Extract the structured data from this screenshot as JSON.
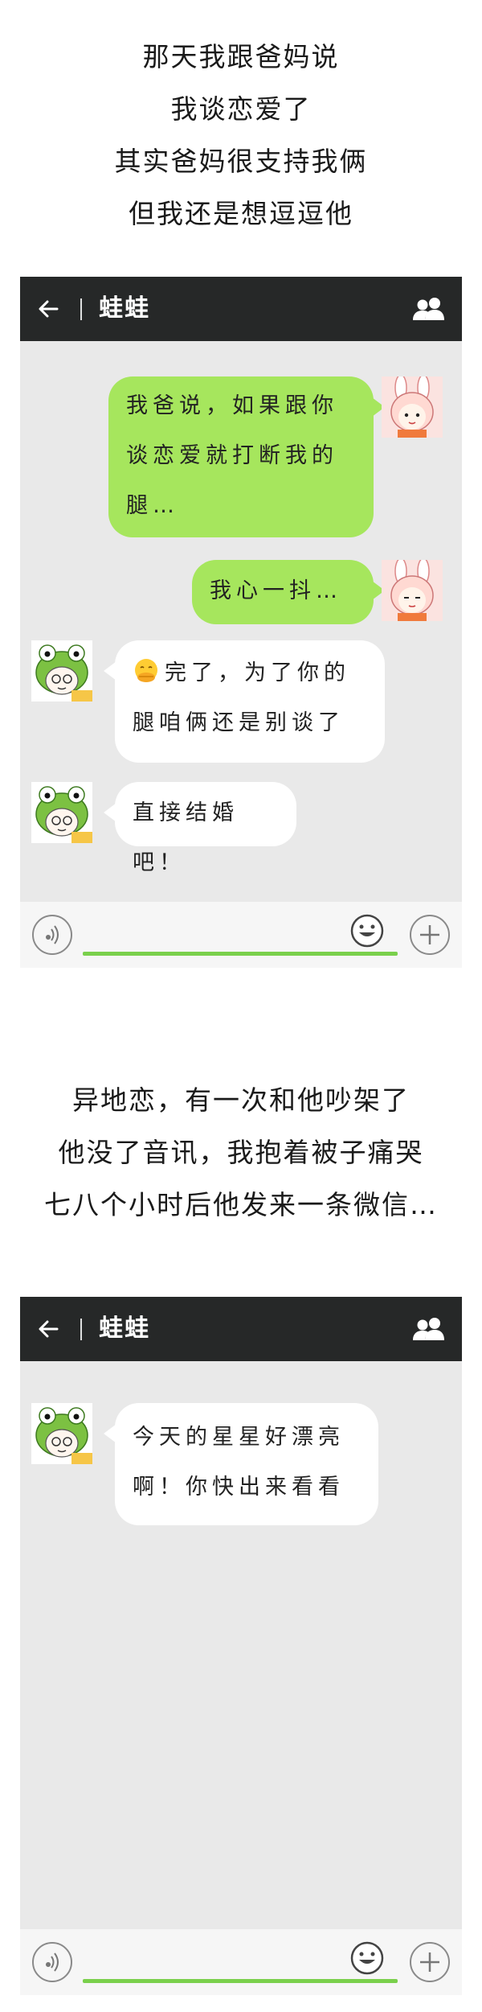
{
  "caption1": {
    "lines": [
      "那天我跟爸妈说",
      "我谈恋爱了",
      "其实爸妈很支持我俩",
      "但我还是想逗逗他"
    ]
  },
  "phone1": {
    "header": {
      "back_icon": "arrow-left-icon",
      "title": "蛙蛙",
      "people_icon": "contacts-icon"
    },
    "messages": [
      {
        "side": "right",
        "text": "我爸说，如果跟你\n谈恋爱就打断我的\n腿…"
      },
      {
        "side": "right",
        "text": "我心一抖…"
      },
      {
        "side": "left",
        "emoji": "face-with-hand-over-mouth",
        "text": "完了，为了你的\n腿咱俩还是别谈了"
      },
      {
        "side": "left",
        "text": "直接结婚吧！"
      }
    ],
    "inputbar": {
      "voice_icon": "voice-icon",
      "emoji_icon": "smile-icon",
      "plus_icon": "plus-icon"
    }
  },
  "caption2": {
    "lines": [
      "异地恋，有一次和他吵架了",
      "他没了音讯，我抱着被子痛哭",
      "七八个小时后他发来一条微信…"
    ]
  },
  "phone2": {
    "header": {
      "back_icon": "arrow-left-icon",
      "title": "蛙蛙",
      "people_icon": "contacts-icon"
    },
    "messages": [
      {
        "side": "left",
        "text": "今天的星星好漂亮\n啊！你快出来看看"
      }
    ],
    "inputbar": {
      "voice_icon": "voice-icon",
      "emoji_icon": "smile-icon",
      "plus_icon": "plus-icon"
    }
  },
  "colors": {
    "titlebar": "#262828",
    "chat_bg": "#e9e9e9",
    "bubble_green": "#a6e65d",
    "bubble_white": "#ffffff",
    "input_line": "#7ad04c"
  }
}
